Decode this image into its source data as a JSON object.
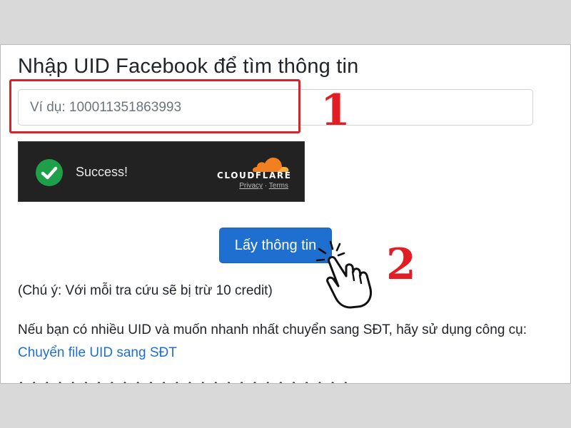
{
  "page": {
    "title": "Nhập UID Facebook để tìm thông tin"
  },
  "uid_input": {
    "placeholder": "Ví dụ: 100011351863993",
    "value": ""
  },
  "annotations": {
    "step_1": "1",
    "step_2": "2",
    "highlight_color": "#d9232b"
  },
  "captcha": {
    "status": "Success!",
    "provider": "CLOUDFLARE",
    "privacy_link": "Privacy",
    "separator": "·",
    "terms_link": "Terms",
    "success_color": "#1ea04a"
  },
  "submit_button": {
    "label": "Lấy thông tin",
    "color": "#1f6fd1"
  },
  "note": "(Chú ý: Với mỗi tra cứu sẽ bị trừ 10 credit)",
  "bulk_info": {
    "text": "Nếu bạn có nhiều UID và muốn nhanh nhất chuyển sang SĐT, hãy sử dụng công cụ: ",
    "link_label": "Chuyển file UID sang SĐT"
  },
  "icons": {
    "check": "check-icon",
    "cursor": "hand-pointer-icon",
    "cloud": "cloudflare-cloud-icon"
  }
}
